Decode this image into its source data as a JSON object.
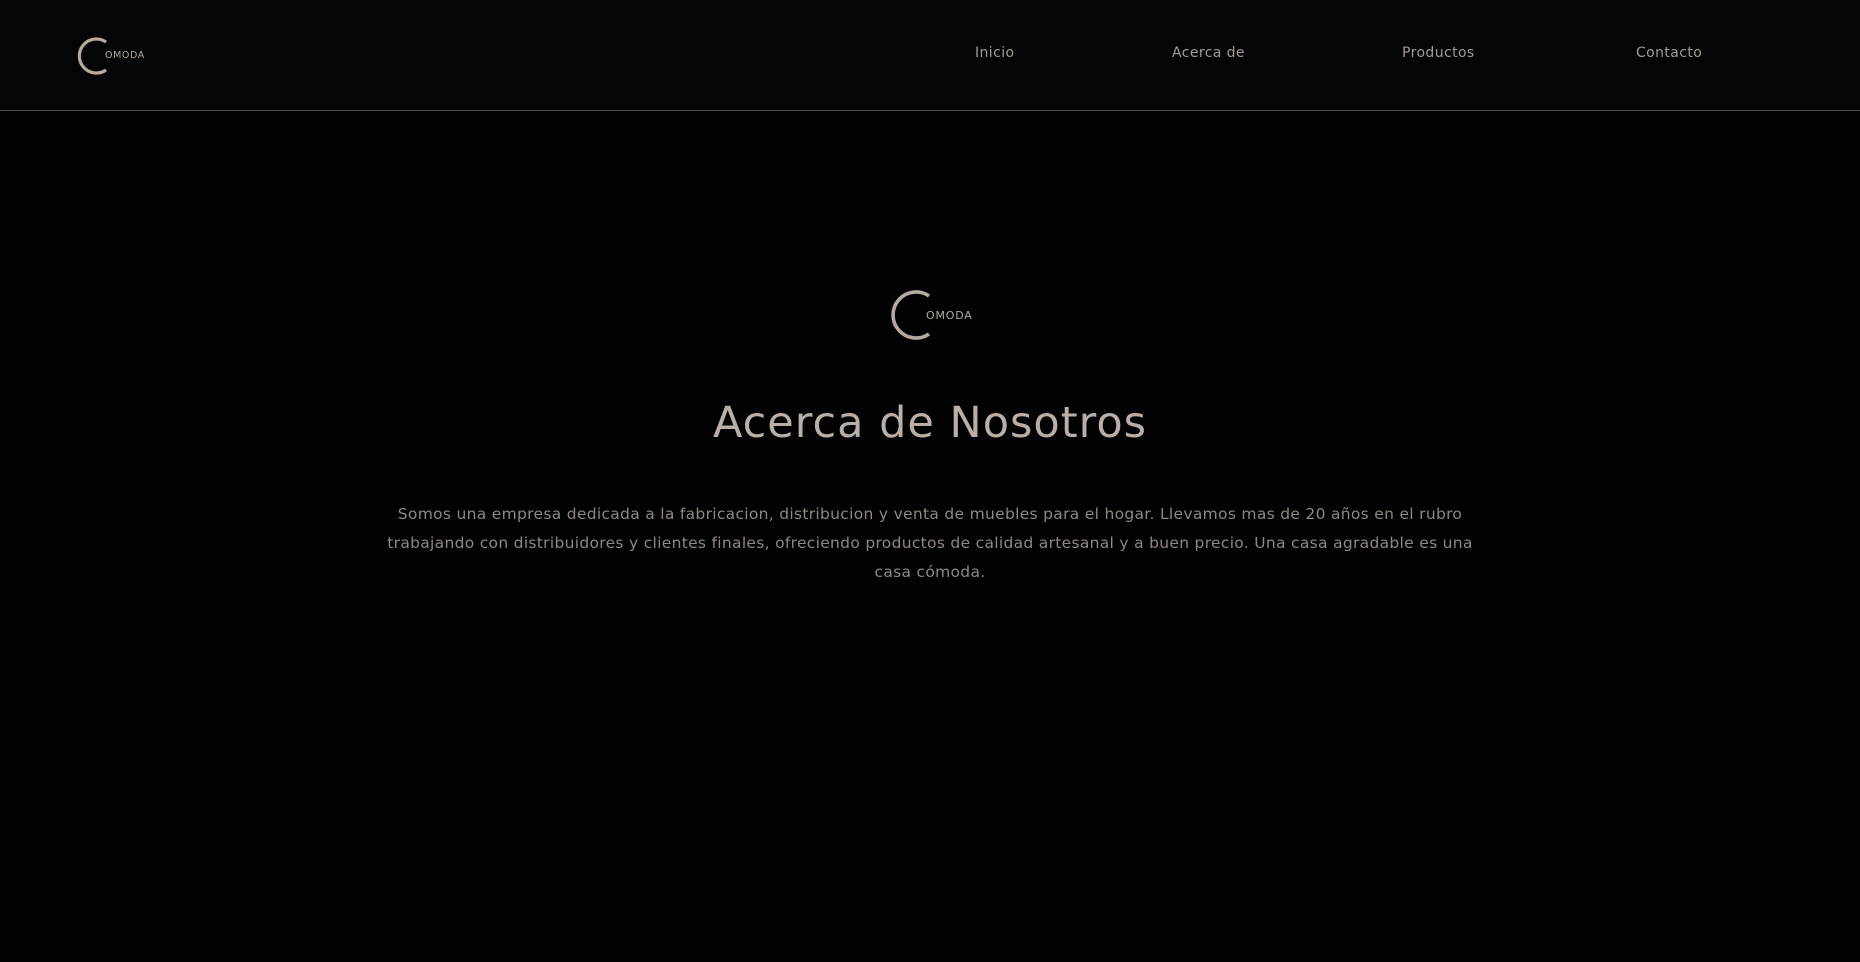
{
  "brand": {
    "logo_text": "OMODA",
    "logo_color": "#b5aaa0"
  },
  "nav": {
    "items": [
      {
        "label": "Inicio"
      },
      {
        "label": "Acerca de"
      },
      {
        "label": "Productos"
      },
      {
        "label": "Contacto"
      }
    ]
  },
  "main": {
    "title": "Acerca de Nosotros",
    "description": "Somos una empresa dedicada a la fabricacion, distribucion y venta de muebles para el hogar. Llevamos mas de 20 años en el rubro trabajando con distribuidores y clientes finales, ofreciendo productos de calidad artesanal y a buen precio. Una casa agradable es una casa cómoda."
  },
  "colors": {
    "background": "#020202",
    "accent": "#b5aaa0",
    "text": "#8f8780"
  }
}
